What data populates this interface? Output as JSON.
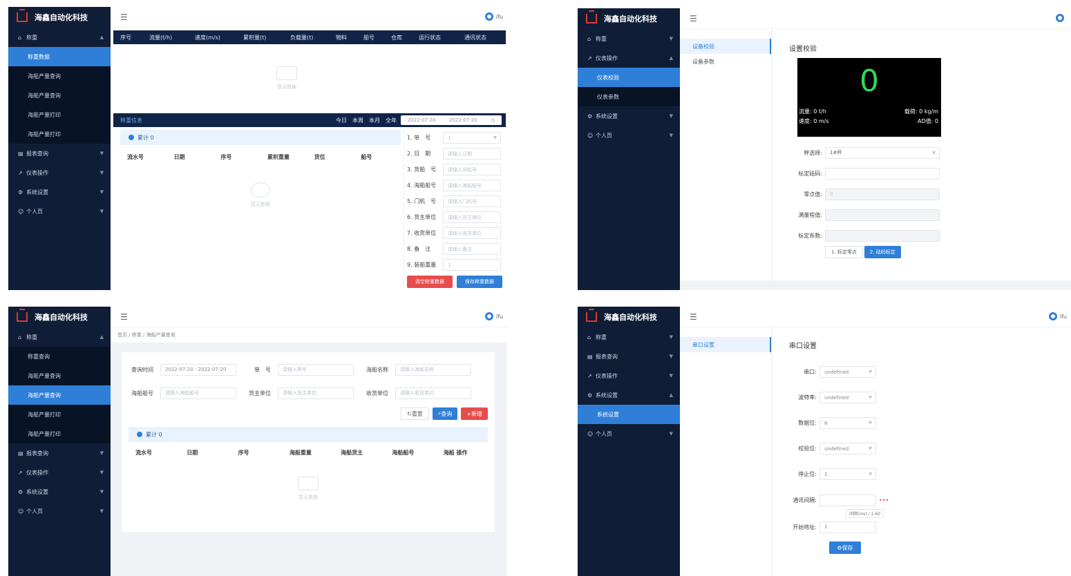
{
  "common": {
    "app_name": "海鑫自动化科技",
    "user_name": "ifu",
    "menu_root": "称重",
    "menu_calibration": "仪表操作",
    "menu_system": "系统设置",
    "menu_personal": "个人页",
    "menu_query": "报表查询"
  },
  "shot1": {
    "sub_items": [
      "称重数据",
      "海船产量查询",
      "海船产量查询",
      "海船产量打印",
      "海船产量打印"
    ],
    "columns": [
      "序号",
      "流量(t/h)",
      "速度(m/s)",
      "累积量(t)",
      "负载量(t)",
      "物料",
      "船号",
      "仓库",
      "运行状态",
      "通讯状态"
    ],
    "empty_text": "暂无数据",
    "detail_title": "称重信息",
    "range_buttons": [
      "今日",
      "本周",
      "本月",
      "全年"
    ],
    "date_start": "2022-07-20",
    "date_end": "2022-07-20",
    "summary_label": "累计 0",
    "list_columns": [
      "流水号",
      "日期",
      "序号",
      "累积重量",
      "货位",
      "船号"
    ],
    "form_fields": [
      {
        "label": "1. 单　号",
        "value": "1"
      },
      {
        "label": "2. 日　期",
        "value": "请输入日期"
      },
      {
        "label": "3. 货船　号",
        "value": "请输入货船号"
      },
      {
        "label": "4. 海船船号",
        "value": "请输入海船船号"
      },
      {
        "label": "5. 门机　号",
        "value": "请输入门机号"
      },
      {
        "label": "6. 货主单位",
        "value": "请输入货主单位"
      },
      {
        "label": "7. 收货单位",
        "value": "请输入收货单位"
      },
      {
        "label": "8. 备　注",
        "value": "请输入备注"
      },
      {
        "label": "9. 装船重量",
        "value": "1"
      }
    ],
    "btn_clear": "清空称重数据",
    "btn_save": "保存称重数据"
  },
  "shot2": {
    "tabs": [
      "设备校验",
      "设备参数"
    ],
    "section_title": "设置校验",
    "big_value": "0",
    "flow_label": "流量: 0 t/h",
    "load_label": "载荷: 0 kg/m",
    "speed_label": "速度: 0 m/s",
    "ad_label": "AD值: 0",
    "fields": [
      {
        "label": "秤选择:",
        "value": "1#秤"
      },
      {
        "label": "标定砝码:",
        "value": ""
      },
      {
        "label": "零点值:",
        "value": "0"
      },
      {
        "label": "满量程值:",
        "value": ""
      },
      {
        "label": "标定系数:",
        "value": ""
      }
    ],
    "btn_zero": "1. 标定零点",
    "btn_span": "2. 砝码标定",
    "sub_items": [
      "仪表校验",
      "仪表参数"
    ]
  },
  "shot3": {
    "breadcrumb": "首页 / 称重 / 海船产量查询",
    "sub_items": [
      "称重查询",
      "海船产量查询",
      "海船产量查询",
      "海船产量打印",
      "海船产量打印"
    ],
    "filters_row1": [
      {
        "label": "查询时间",
        "value": "2022-07-20 - 2022-07-20"
      },
      {
        "label": "单　号",
        "value": "请输入单号"
      },
      {
        "label": "海船名称",
        "value": "请输入海船名称"
      }
    ],
    "filters_row2": [
      {
        "label": "海船船号",
        "value": "请输入海船船号"
      },
      {
        "label": "货主单位",
        "value": "请输入货主单位"
      },
      {
        "label": "收货单位",
        "value": "请输入收货单位"
      }
    ],
    "btn_reset": "重置",
    "btn_search": "查询",
    "btn_add": "新增",
    "summary_label": "累计 0",
    "columns": [
      "流水号",
      "日期",
      "序号",
      "海船重量",
      "海船货主",
      "海船船号",
      "海船 操作"
    ],
    "empty_text": "暂无数据"
  },
  "shot4": {
    "tab": "串口设置",
    "section_title": "串口设置",
    "fields": [
      {
        "label": "串口:",
        "value": "undefined"
      },
      {
        "label": "波特率:",
        "value": "undefined"
      },
      {
        "label": "数据位:",
        "value": "8"
      },
      {
        "label": "校验位:",
        "value": "undefined"
      },
      {
        "label": "停止位:",
        "value": "1"
      }
    ],
    "comm_label": "通讯间隔:",
    "comm_hint": "间隔(ms) / 1-60",
    "start_label": "开始地址:",
    "start_value": "1",
    "btn_save": "保存",
    "sub_items": [
      "系统设置"
    ]
  }
}
